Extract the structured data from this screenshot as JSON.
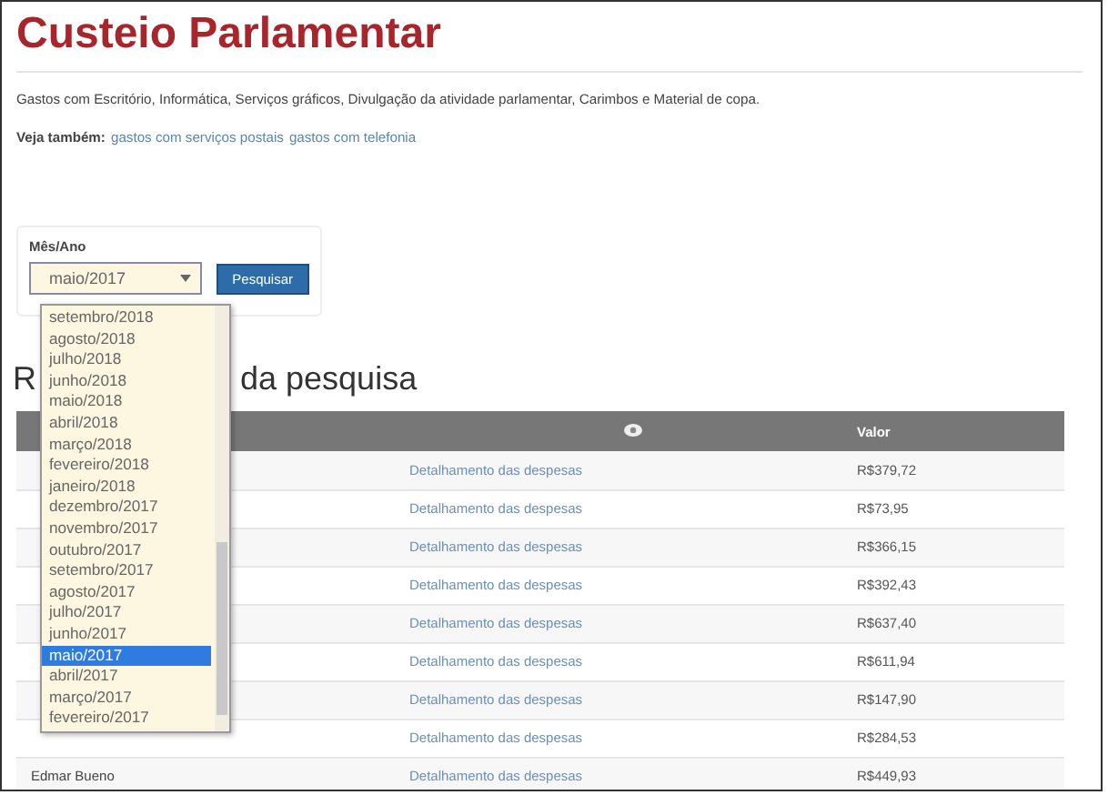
{
  "title": "Custeio Parlamentar",
  "description": "Gastos com Escritório, Informática, Serviços gráficos, Divulgação da atividade parlamentar, Carimbos e Material de copa.",
  "see_also": {
    "label": "Veja também:",
    "links": [
      "gastos com serviços postais",
      "gastos com telefonia"
    ]
  },
  "form": {
    "label": "Mês/Ano",
    "select_value": "maio/2017",
    "button": "Pesquisar",
    "options": [
      {
        "label": "setembro/2018",
        "selected": false
      },
      {
        "label": "agosto/2018",
        "selected": false
      },
      {
        "label": "julho/2018",
        "selected": false
      },
      {
        "label": "junho/2018",
        "selected": false
      },
      {
        "label": "maio/2018",
        "selected": false
      },
      {
        "label": "abril/2018",
        "selected": false
      },
      {
        "label": "março/2018",
        "selected": false
      },
      {
        "label": "fevereiro/2018",
        "selected": false
      },
      {
        "label": "janeiro/2018",
        "selected": false
      },
      {
        "label": "dezembro/2017",
        "selected": false
      },
      {
        "label": "novembro/2017",
        "selected": false
      },
      {
        "label": "outubro/2017",
        "selected": false
      },
      {
        "label": "setembro/2017",
        "selected": false
      },
      {
        "label": "agosto/2017",
        "selected": false
      },
      {
        "label": "julho/2017",
        "selected": false
      },
      {
        "label": "junho/2017",
        "selected": false
      },
      {
        "label": "maio/2017",
        "selected": true
      },
      {
        "label": "abril/2017",
        "selected": false
      },
      {
        "label": "março/2017",
        "selected": false
      },
      {
        "label": "fevereiro/2017",
        "selected": false
      }
    ]
  },
  "results": {
    "heading_start": "R",
    "heading_end": "da pesquisa",
    "columns": [
      {
        "kind": "blank"
      },
      {
        "kind": "eye"
      },
      {
        "kind": "text",
        "label": "Valor"
      }
    ],
    "rows": [
      {
        "name": "",
        "link": "Detalhamento das despesas",
        "value": "R$379,72"
      },
      {
        "name": "",
        "link": "Detalhamento das despesas",
        "value": "R$73,95"
      },
      {
        "name": "",
        "link": "Detalhamento das despesas",
        "value": "R$366,15"
      },
      {
        "name": "",
        "link": "Detalhamento das despesas",
        "value": "R$392,43"
      },
      {
        "name": "",
        "link": "Detalhamento das despesas",
        "value": "R$637,40"
      },
      {
        "name": "",
        "link": "Detalhamento das despesas",
        "value": "R$611,94"
      },
      {
        "name": "",
        "link": "Detalhamento das despesas",
        "value": "R$147,90"
      },
      {
        "name": "",
        "link": "Detalhamento das despesas",
        "value": "R$284,53"
      },
      {
        "name": "Edmar Bueno",
        "link": "Detalhamento das despesas",
        "value": "R$449,93"
      }
    ]
  }
}
